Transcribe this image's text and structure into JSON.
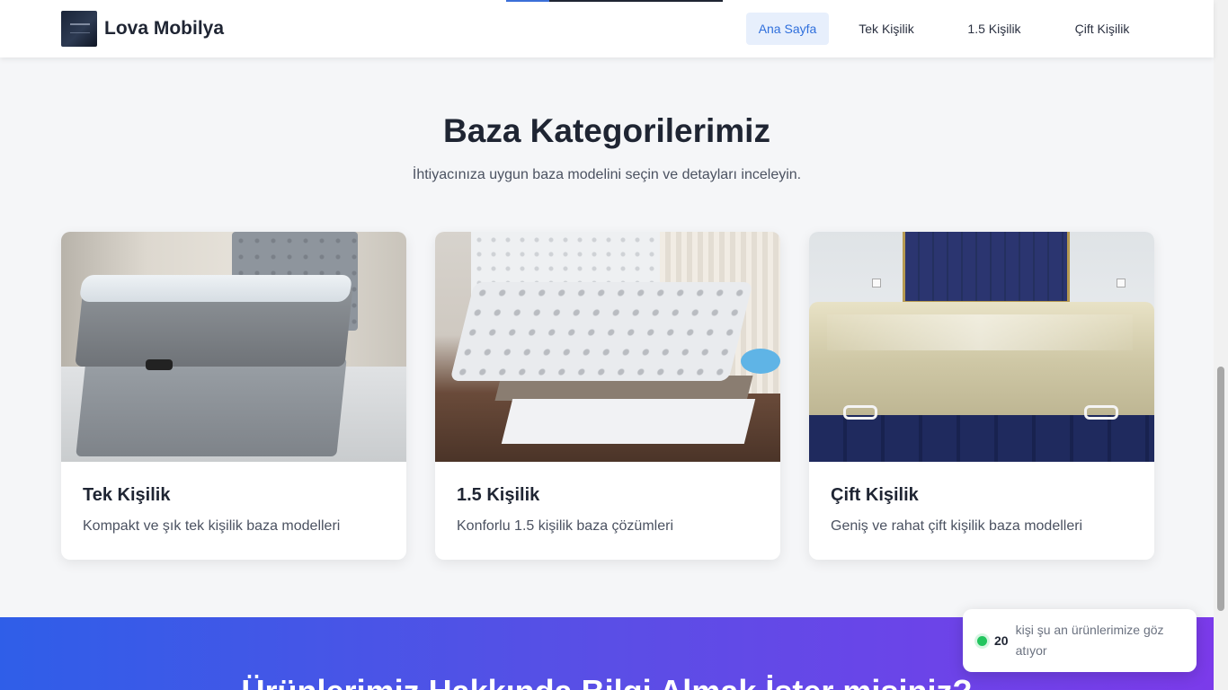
{
  "header": {
    "brand": "Lova Mobilya",
    "nav": [
      {
        "label": "Ana Sayfa",
        "active": true
      },
      {
        "label": "Tek Kişilik",
        "active": false
      },
      {
        "label": "1.5 Kişilik",
        "active": false
      },
      {
        "label": "Çift Kişilik",
        "active": false
      }
    ]
  },
  "section": {
    "title": "Baza Kategorilerimiz",
    "subtitle": "İhtiyacınıza uygun baza modelini seçin ve detayları inceleyin."
  },
  "cards": [
    {
      "title": "Tek Kişilik",
      "description": "Kompakt ve şık tek kişilik baza modelleri"
    },
    {
      "title": "1.5 Kişilik",
      "description": "Konforlu 1.5 kişilik baza çözümleri"
    },
    {
      "title": "Çift Kişilik",
      "description": "Geniş ve rahat çift kişilik baza modelleri"
    }
  ],
  "cta": {
    "title": "Ürünlerimiz Hakkında Bilgi Almak İster misiniz?"
  },
  "viewers": {
    "count": "20",
    "text": "kişi şu an ürünlerimize göz atıyor"
  },
  "colors": {
    "accent": "#2f6fdc",
    "active_bg": "#e7effc",
    "live": "#22c55e",
    "gradient_start": "#2f5ee8",
    "gradient_end": "#7b3bea"
  }
}
